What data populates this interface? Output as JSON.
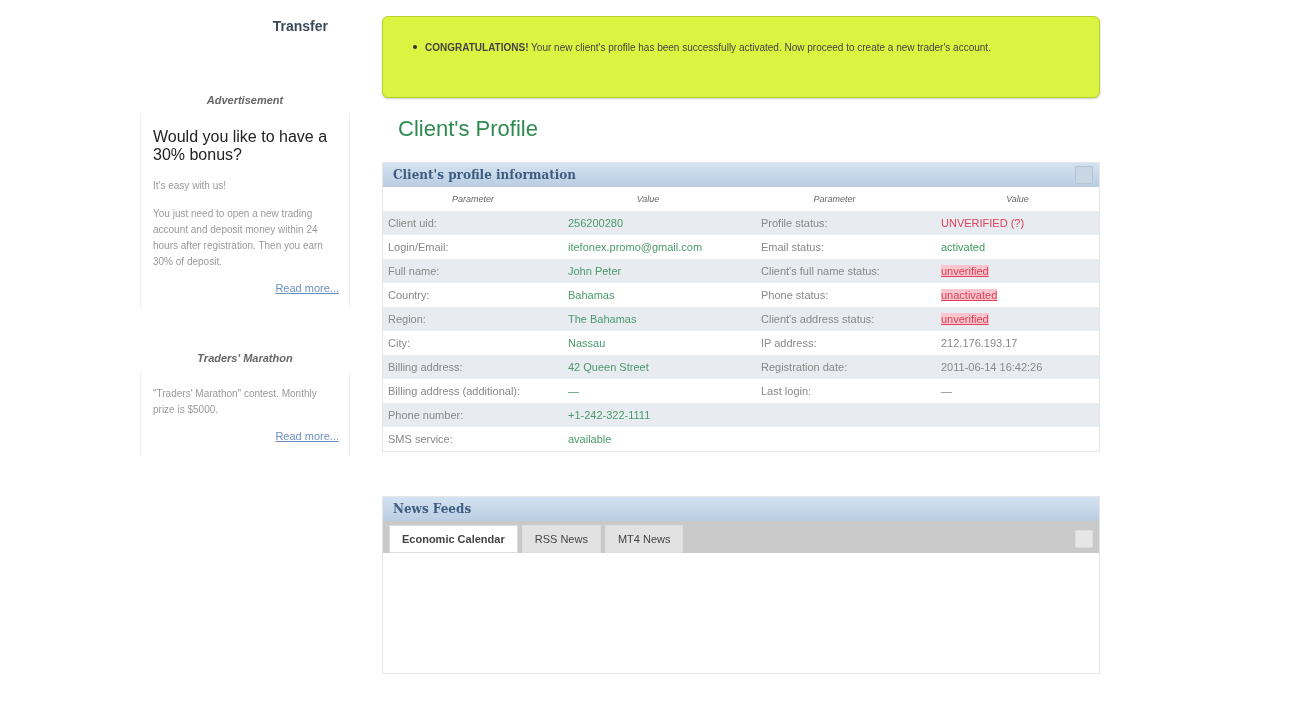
{
  "sidebar": {
    "transfer_link": "Transfer",
    "blocks": [
      {
        "heading": "Advertisement",
        "title": "Would you like to have a 30% bonus?",
        "paragraphs": [
          "It's easy with us!",
          "You just need to open a new trading account and deposit money within 24 hours after registration. Then you earn 30% of deposit."
        ],
        "link": "Read more..."
      },
      {
        "heading": "Traders' Marathon",
        "paragraphs": [
          "\"Traders' Marathon\" contest. Monthly prize is $5000."
        ],
        "link": "Read more..."
      }
    ]
  },
  "notice": {
    "text": "**CONGRATULATIONS!** Your new client's profile has been successfully activated. Now proceed to create a new trader's account."
  },
  "page_title": "Client's Profile",
  "profile_panel": {
    "title": "Client's profile information",
    "columns": [
      "Parameter",
      "Value",
      "Parameter",
      "Value"
    ],
    "rows": [
      {
        "param": "Client uid:",
        "value": "256200280",
        "param2": "Profile status:",
        "value2": "UNVERIFIED (?)",
        "kind": "alert"
      },
      {
        "param": "Login/Email:",
        "value": "itefonex.promo@gmail.com",
        "param2": "Email status:",
        "value2": "activated",
        "kind": "ok"
      },
      {
        "param": "Full name:",
        "value": "John Peter",
        "param2": "Client's full name status:",
        "value2": "unverified",
        "kind": "bad"
      },
      {
        "param": "Country:",
        "value": "Bahamas",
        "param2": "Phone status:",
        "value2": "unactivated",
        "kind": "bad"
      },
      {
        "param": "Region:",
        "value": "The Bahamas",
        "param2": "Client's address status:",
        "value2": "unverified",
        "kind": "bad"
      },
      {
        "param": "City:",
        "value": "Nassau",
        "param2": "IP address:",
        "value2": "212.176.193.17",
        "kind": "plain"
      },
      {
        "param": "Billing address:",
        "value": "42 Queen Street",
        "param2": "Registration date:",
        "value2": "2011-06-14 16:42:26",
        "kind": "plain"
      },
      {
        "param": "Billing address (additional):",
        "value": "—",
        "param2": "Last login:",
        "value2": "—",
        "kind": "plain"
      },
      {
        "param": "Phone number:",
        "value": "+1-242-322-1111"
      },
      {
        "param": "SMS service:",
        "value": "available"
      }
    ]
  },
  "news_panel": {
    "title": "News Feeds",
    "tabs": [
      {
        "label": "Economic Calendar",
        "selected": true
      },
      {
        "label": "RSS News",
        "selected": false
      },
      {
        "label": "MT4 News",
        "selected": false
      }
    ]
  }
}
